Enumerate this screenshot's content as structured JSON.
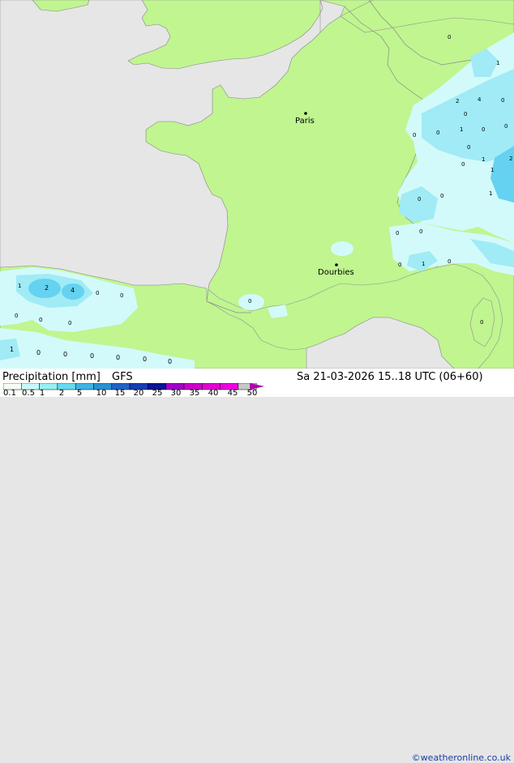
{
  "legend": {
    "title": "Precipitation [mm]",
    "model": "GFS",
    "ticks": [
      "0.1",
      "0.5",
      "1",
      "2",
      "5",
      "10",
      "15",
      "20",
      "25",
      "30",
      "35",
      "40",
      "45",
      "50"
    ],
    "colors": [
      "#f5fff5",
      "#c8fafa",
      "#96f0f5",
      "#64dcf0",
      "#3cb4e6",
      "#2891d2",
      "#1e64c8",
      "#143cb4",
      "#0a1496",
      "#a000c8",
      "#c800c8",
      "#e100d2",
      "#f000e1",
      "#c8c8c8"
    ]
  },
  "valid_time": "Sa 21-03-2026 15..18 UTC (06+60)",
  "credit": "©weatheronline.co.uk",
  "cities": [
    {
      "name": "Paris"
    },
    {
      "name": "Dourbies"
    }
  ],
  "precip_labels": [
    "0",
    "1",
    "2",
    "4",
    "0",
    "0",
    "1",
    "0",
    "0",
    "0",
    "0",
    "0",
    "1",
    "1",
    "0",
    "0",
    "0",
    "0",
    "0",
    "1",
    "2",
    "0",
    "1",
    "0",
    "0",
    "0",
    "0",
    "0",
    "0",
    "1",
    "0",
    "0"
  ],
  "colors": {
    "land": "#c0f590",
    "sea": "#e6e6e6",
    "light_rain": "#d2fafa",
    "rain": "#a0ebf5",
    "heavy": "#64d2f0",
    "border": "#808080"
  }
}
